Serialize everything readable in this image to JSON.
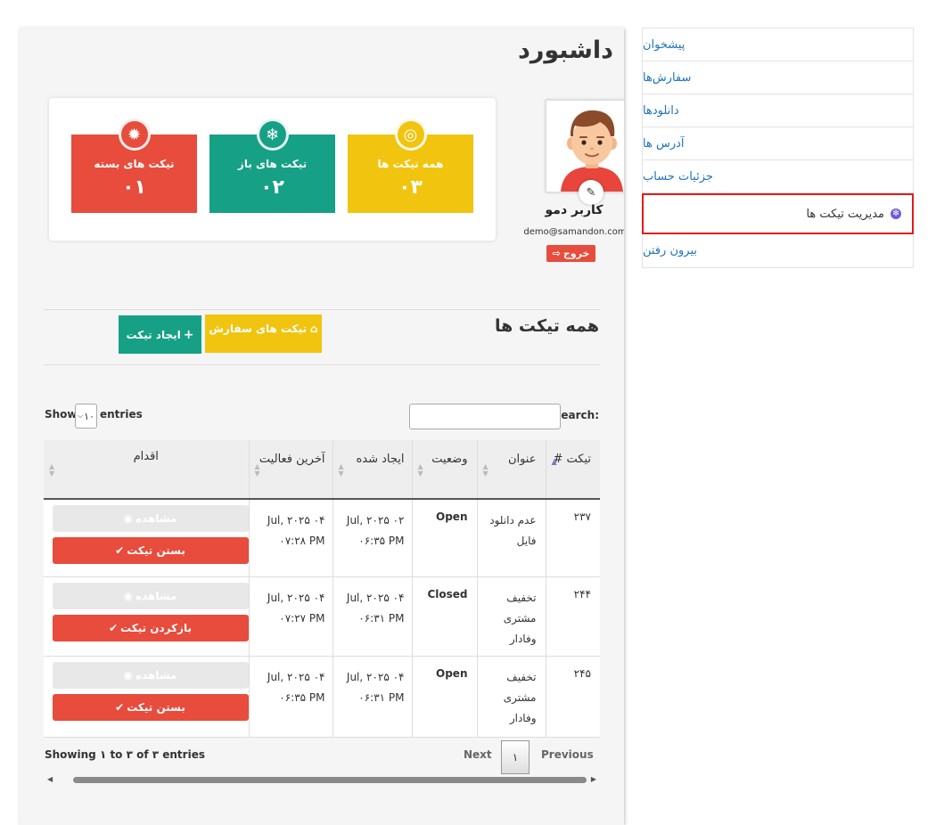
{
  "sidebar": {
    "items": [
      {
        "label": "پیشخوان"
      },
      {
        "label": "سفارش‌ها"
      },
      {
        "label": "دانلودها"
      },
      {
        "label": "آدرس ها"
      },
      {
        "label": "جزئیات حساب"
      },
      {
        "label": "مدیریت تیکت ها",
        "active": true
      },
      {
        "label": "بیرون رفتن"
      }
    ]
  },
  "page": {
    "title": "داشبورد"
  },
  "stats": {
    "all": {
      "label": "همه تیکت ها",
      "value": "۰۳",
      "color": "#f1c40f"
    },
    "open": {
      "label": "تیکت های باز",
      "value": "۰۲",
      "color": "#16a085"
    },
    "closed": {
      "label": "تیکت های بسته",
      "value": "۰۱",
      "color": "#e74c3c"
    }
  },
  "profile": {
    "name": "کاربر دمو",
    "email": "demo@samandon.com",
    "logout": "خروج"
  },
  "tickets": {
    "title": "همه تیکت ها",
    "order_tickets_btn": "تیکت های سفارش",
    "create_ticket_btn": "ایجاد تیکت",
    "search_label": "Search:",
    "search_value": "",
    "show_label": "Show",
    "page_length": "۱۰",
    "entries_label": "entries",
    "columns": {
      "id": "تیکت #",
      "title": "عنوان",
      "status": "وضعیت",
      "created": "ایجاد شده",
      "updated": "آخرین فعالیت",
      "action": "اقدام"
    },
    "rows": [
      {
        "id": "۲۳۷",
        "title": "عدم دانلود فایل",
        "status": "Open",
        "created_date": "Jul, ۲۰۲۵ ۰۲",
        "created_time": "۰۶:۳۵ PM",
        "updated_date": "Jul, ۲۰۲۵ ۰۴",
        "updated_time": "۰۷:۲۸ PM",
        "view": "مشاهده",
        "action": "بستن تیکت"
      },
      {
        "id": "۲۴۴",
        "title": "تخفیف مشتری وفادار",
        "status": "Closed",
        "created_date": "Jul, ۲۰۲۵ ۰۴",
        "created_time": "۰۶:۳۱ PM",
        "updated_date": "Jul, ۲۰۲۵ ۰۴",
        "updated_time": "۰۷:۲۷ PM",
        "view": "مشاهده",
        "action": "بازکردن تیکت"
      },
      {
        "id": "۲۴۵",
        "title": "تخفیف مشتری وفادار",
        "status": "Open",
        "created_date": "Jul, ۲۰۲۵ ۰۴",
        "created_time": "۰۶:۳۱ PM",
        "updated_date": "Jul, ۲۰۲۵ ۰۴",
        "updated_time": "۰۶:۳۵ PM",
        "view": "مشاهده",
        "action": "بستن تیکت"
      }
    ],
    "info": "Showing ۱ to ۳ of ۳ entries",
    "pagination": {
      "previous": "Previous",
      "current": "۱",
      "next": "Next"
    }
  },
  "colors": {
    "link": "#1e73be",
    "danger": "#e74c3c",
    "success": "#16a085",
    "warning": "#f1c40f",
    "active_border": "#e31b1b"
  }
}
